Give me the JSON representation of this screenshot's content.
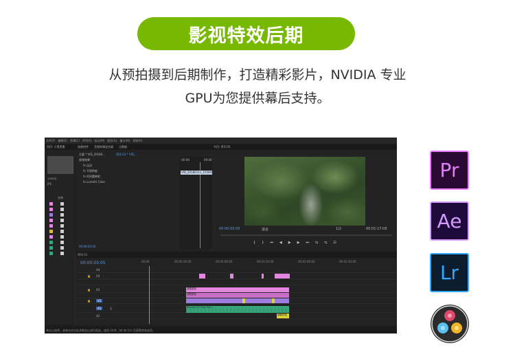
{
  "headline": "影视特效后期",
  "subtitle": {
    "line1": "从预拍摄到后期制作，打造精彩影片，NVIDIA 专业",
    "line2": "GPU为您提供幕后支持。"
  },
  "editor": {
    "menu": [
      "文件(F)",
      "编辑(E)",
      "剪辑(C)",
      "序列(S)",
      "标记(M)",
      "图形(G)",
      "窗口(W)",
      "帮助(H)"
    ],
    "project": {
      "tab": "项目: 小黑黑素",
      "file_label": ".prproj",
      "search_label": "JPE",
      "name_header": "名称",
      "bin_colors": [
        "#e386e0",
        "#e386e0",
        "#9c7de0",
        "#e386e0",
        "#e386e0",
        "#d8b93c",
        "#e386e0",
        "#39a57a",
        "#39a57a",
        "#39a57a"
      ]
    },
    "effects": {
      "tabs": [
        "效果控件",
        "音频剪辑混合器",
        "元数据"
      ],
      "source_label": "主要 * VID_20180...",
      "sequence_label": "序列 01 * VID_...",
      "section": "视频效果",
      "items": [
        "运动",
        "不透明度",
        "时间重映射",
        "Lumetri Color"
      ],
      "time_start": ":00:00",
      "time_end": "00:00:05:00",
      "clip_name": "VID_20180111_155945.mp4",
      "timecode": "00:00:03:05"
    },
    "program": {
      "tab": "节目: 序列 01",
      "current_tc": "00:00:03:05",
      "fit": "适合",
      "quality": "1/2",
      "duration_tc": "00:01:17:09",
      "controls": [
        "{",
        "}",
        "⏮",
        "◀",
        "▶",
        "▶",
        "⏭",
        "⇆",
        "⇆",
        "⊡"
      ]
    },
    "timeline": {
      "tab": "序列 01",
      "timecode": "00:00:03:05",
      "ruler": [
        "00:00",
        "00:00:30:00",
        "00:01:00:00",
        "00:01:30:00",
        "00:02:00:00",
        "00:02:30:00"
      ],
      "tracks": [
        "V4",
        "V3",
        "V2",
        "V1",
        "A1",
        "A2"
      ],
      "clip_labels": {
        "v2a": "调整图层",
        "v2b": "调整图层",
        "a1_label": "Blessed (in Rise Hou...",
        "a1_tail": "朝朝呼吸"
      }
    },
    "status": "单击以选择，或单击空白处并拖动以进行框选。使用 Shift、Alt 和 Ctrl 可获得其他选项。"
  },
  "apps": {
    "premiere": "Pr",
    "after_effects": "Ae",
    "lightroom": "Lr",
    "resolve_icon": "davinci-resolve-icon"
  },
  "colors": {
    "accent": "#76b900",
    "pr": "#e77bff",
    "ae": "#d69bff",
    "lr": "#31a8ff"
  }
}
